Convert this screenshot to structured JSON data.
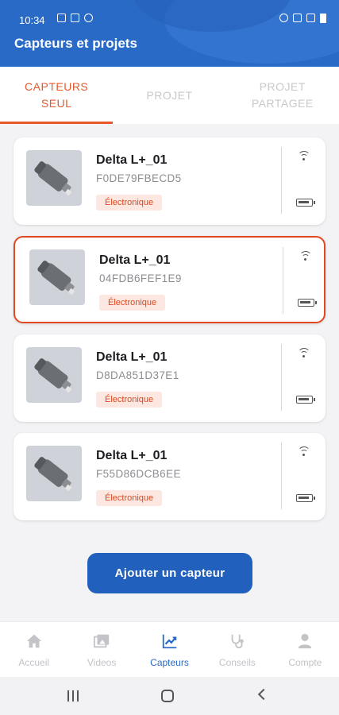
{
  "statusbar": {
    "time": "10:34"
  },
  "header": {
    "title": "Capteurs et projets"
  },
  "tabs": [
    {
      "label": "CAPTEURS SEUL",
      "active": true
    },
    {
      "label": "PROJET",
      "active": false
    },
    {
      "label": "PROJET PARTAGEE",
      "active": false
    }
  ],
  "sensors": [
    {
      "name": "Delta L+_01",
      "id": "F0DE79FBECD5",
      "badge": "Électronique",
      "selected": false
    },
    {
      "name": "Delta L+_01",
      "id": "04FDB6FEF1E9",
      "badge": "Électronique",
      "selected": true
    },
    {
      "name": "Delta L+_01",
      "id": "D8DA851D37E1",
      "badge": "Électronique",
      "selected": false
    },
    {
      "name": "Delta L+_01",
      "id": "F55D86DCB6EE",
      "badge": "Électronique",
      "selected": false
    }
  ],
  "add_button": {
    "label": "Ajouter un capteur"
  },
  "bottomnav": [
    {
      "label": "Accueil",
      "icon": "home-icon",
      "active": false
    },
    {
      "label": "Videos",
      "icon": "video-icon",
      "active": false
    },
    {
      "label": "Capteurs",
      "icon": "chart-icon",
      "active": true
    },
    {
      "label": "Conseils",
      "icon": "stethoscope-icon",
      "active": false
    },
    {
      "label": "Compte",
      "icon": "user-icon",
      "active": false
    }
  ],
  "colors": {
    "primary": "#2a6ac7",
    "accent": "#e8582b",
    "badge_bg": "#fde8e1"
  }
}
